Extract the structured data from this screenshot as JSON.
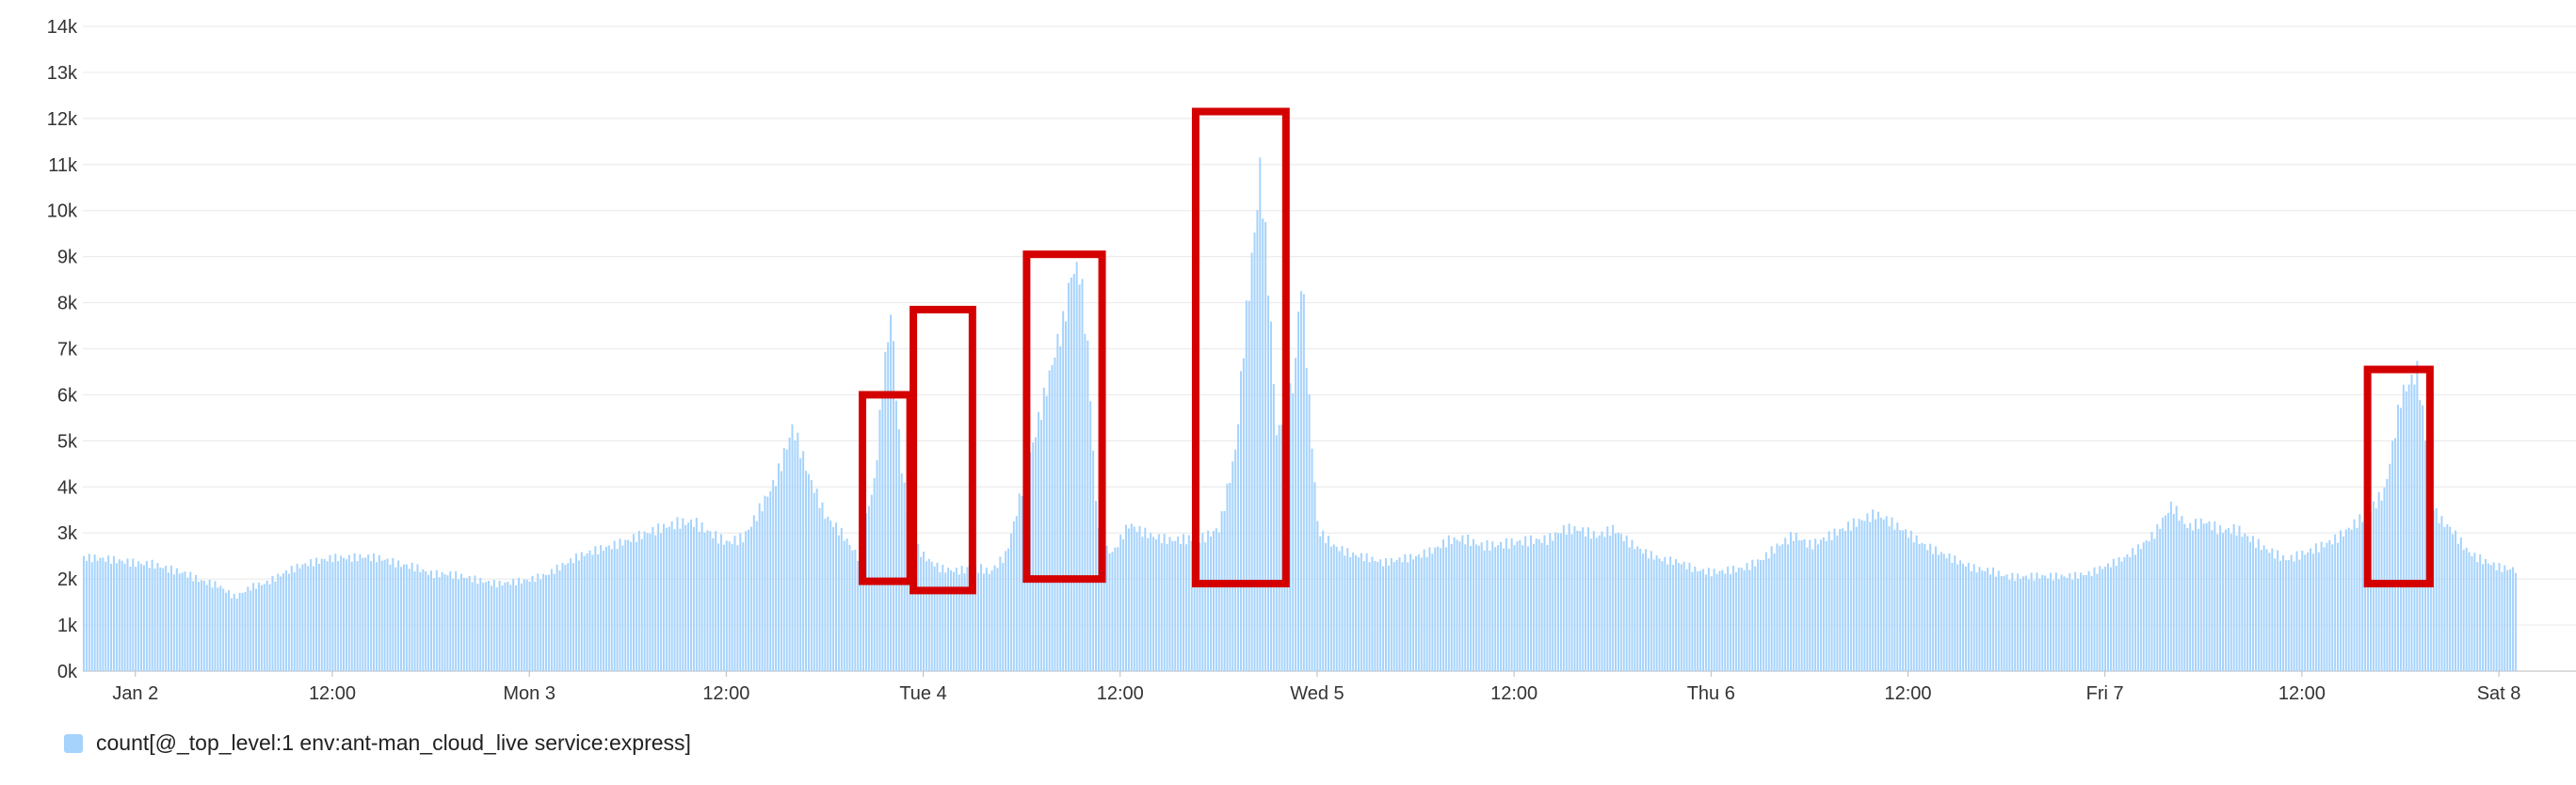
{
  "chart_data": {
    "type": "bar",
    "title": "",
    "xlabel": "",
    "ylabel": "",
    "ylim": [
      0,
      14000
    ],
    "grid": true,
    "legend_position": "bottom-left",
    "y_ticks": [
      "0k",
      "1k",
      "2k",
      "3k",
      "4k",
      "5k",
      "6k",
      "7k",
      "8k",
      "9k",
      "10k",
      "11k",
      "12k",
      "13k",
      "14k"
    ],
    "x_ticks": [
      "Jan 2",
      "12:00",
      "Mon 3",
      "12:00",
      "Tue 4",
      "12:00",
      "Wed 5",
      "12:00",
      "Thu 6",
      "12:00",
      "Fri 7",
      "12:00",
      "Sat 8"
    ],
    "x_ticks_hours": [
      12,
      24,
      36,
      48,
      60,
      72,
      84,
      96,
      108,
      120,
      132,
      144,
      156
    ],
    "x_range_hours": [
      8.8,
      160.7
    ],
    "series": [
      {
        "name": "count[@_top_level:1 env:ant-man_cloud_live service:express]",
        "color": "#a6d3fc",
        "x_hours": [
          8.8,
          10,
          11,
          12,
          13,
          14,
          15,
          16,
          17,
          18,
          19,
          20,
          21,
          22,
          23,
          24,
          25,
          26,
          27,
          28,
          29,
          30,
          31,
          32,
          33,
          34,
          35,
          36,
          37,
          38,
          39,
          40,
          41,
          42,
          43,
          44,
          45,
          46,
          47,
          48,
          49,
          50,
          51,
          52,
          53,
          54,
          55,
          56,
          56.5,
          57,
          57.5,
          58,
          58.5,
          59,
          59.5,
          60,
          60.5,
          61,
          61.5,
          62,
          62.5,
          63,
          63.5,
          64,
          65,
          66,
          67,
          68,
          68.5,
          69,
          69.5,
          70,
          70.5,
          71,
          71.5,
          72,
          72.5,
          73,
          74,
          75,
          76,
          77,
          78,
          79,
          79.5,
          80,
          80.5,
          81,
          81.5,
          82,
          82.5,
          83,
          83.5,
          84,
          85,
          86,
          87,
          88,
          89,
          90,
          91,
          92,
          93,
          94,
          95,
          96,
          97,
          98,
          99,
          100,
          101,
          102,
          103,
          104,
          105,
          106,
          107,
          108,
          109,
          110,
          111,
          112,
          113,
          114,
          115,
          116,
          117,
          118,
          119,
          120,
          121,
          122,
          123,
          124,
          125,
          126,
          127,
          128,
          129,
          130,
          131,
          132,
          133,
          134,
          135,
          136,
          137,
          138,
          139,
          140,
          141,
          142,
          143,
          144,
          145,
          146,
          147,
          148,
          149,
          150,
          151,
          152,
          152.5,
          153,
          153.5,
          154,
          154.5,
          155,
          155.5,
          156,
          157,
          158,
          159,
          160,
          160.7
        ],
        "values": [
          2300,
          2300,
          2300,
          2300,
          2350,
          2300,
          2250,
          2100,
          2000,
          1700,
          1900,
          1950,
          2100,
          2200,
          2250,
          2300,
          2300,
          2350,
          2350,
          2300,
          2300,
          2200,
          2250,
          2200,
          2100,
          2000,
          2000,
          2000,
          2050,
          2200,
          2350,
          2450,
          2550,
          2700,
          2900,
          3100,
          3300,
          3400,
          3200,
          3000,
          3100,
          3700,
          4300,
          5300,
          4100,
          3200,
          2800,
          2300,
          3200,
          3900,
          6000,
          7500,
          4700,
          3300,
          2700,
          2500,
          2400,
          2300,
          2300,
          2300,
          2350,
          2350,
          2400,
          2300,
          2700,
          4200,
          5600,
          6900,
          7400,
          8400,
          8300,
          6500,
          3200,
          2500,
          2400,
          2700,
          3000,
          2900,
          2800,
          2800,
          2900,
          3000,
          3300,
          5200,
          7800,
          9700,
          11700,
          8800,
          5200,
          6200,
          6300,
          8800,
          5600,
          3000,
          2600,
          2400,
          2300,
          2200,
          2300,
          2400,
          2600,
          2900,
          3000,
          2900,
          2950,
          3000,
          3000,
          2950,
          3100,
          3000,
          2800,
          2900,
          2600,
          2400,
          2300,
          2300,
          2200,
          2200,
          2300,
          2400,
          2600,
          2900,
          3100,
          2800,
          2900,
          3000,
          3100,
          3200,
          3000,
          2800,
          2600,
          2500,
          2400,
          2300,
          2300,
          2200,
          2200,
          2200,
          2150,
          2100,
          2100,
          2200,
          2300,
          2500,
          2800,
          3400,
          3000,
          3200,
          3100,
          3200,
          3000,
          2800,
          2600,
          2700,
          2800,
          2900,
          3100,
          3300,
          3700,
          5600,
          6100,
          3300,
          3100,
          3000,
          2800,
          2600,
          2500,
          2450,
          2400,
          2350,
          2350
        ]
      }
    ]
  },
  "legend": {
    "label": "count[@_top_level:1 env:ant-man_cloud_live service:express]",
    "color": "#a6d3fc"
  },
  "highlight_color": "#d40000"
}
